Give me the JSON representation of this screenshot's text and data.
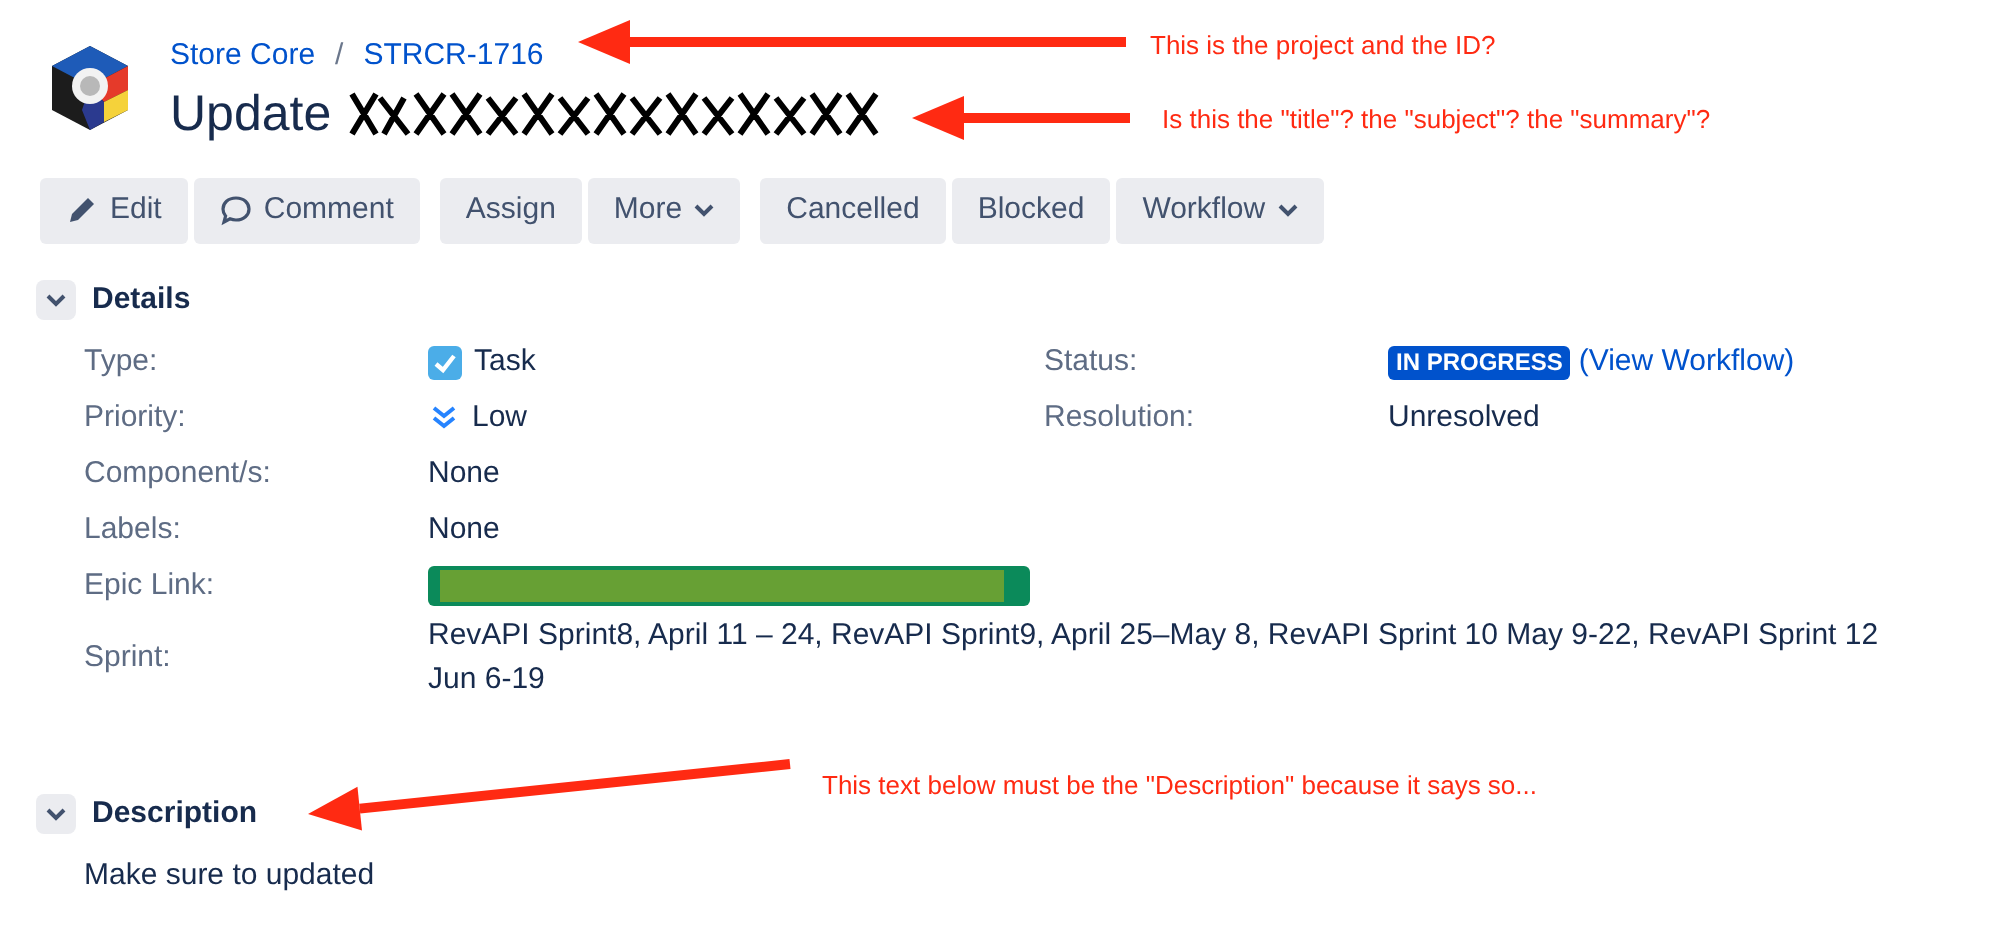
{
  "breadcrumb": {
    "project": "Store Core",
    "separator": "/",
    "issue_key": "STRCR-1716"
  },
  "title": "Update",
  "toolbar_groups": [
    [
      {
        "label": "Edit",
        "kind": "edit"
      },
      {
        "label": "Comment",
        "kind": "comment"
      }
    ],
    [
      {
        "label": "Assign",
        "kind": "plain"
      },
      {
        "label": "More",
        "kind": "menu"
      }
    ],
    [
      {
        "label": "Cancelled",
        "kind": "plain"
      },
      {
        "label": "Blocked",
        "kind": "plain"
      },
      {
        "label": "Workflow",
        "kind": "menu"
      }
    ]
  ],
  "details": {
    "heading": "Details",
    "expanded": true,
    "left": [
      {
        "label": "Type:",
        "value": "Task",
        "kind": "type"
      },
      {
        "label": "Priority:",
        "value": "Low",
        "kind": "priority"
      },
      {
        "label": "Component/s:",
        "value": "None",
        "kind": "text"
      },
      {
        "label": "Labels:",
        "value": "None",
        "kind": "text"
      },
      {
        "label": "Epic Link:",
        "kind": "redacted"
      },
      {
        "label": "Sprint:",
        "value": "RevAPI Sprint8, April 11 – 24, RevAPI Sprint9, April 25–May 8, RevAPI Sprint 10 May 9-22, RevAPI Sprint 12 Jun 6-19",
        "kind": "wide"
      }
    ],
    "right": [
      {
        "label": "Status:",
        "lozenge": "IN PROGRESS",
        "link": "(View Workflow)",
        "kind": "status"
      },
      {
        "label": "Resolution:",
        "value": "Unresolved",
        "kind": "text"
      }
    ]
  },
  "description": {
    "heading": "Description",
    "expanded": true,
    "text": "Make sure to updated"
  },
  "annotations": [
    {
      "text": "This is the project and the ID?"
    },
    {
      "text": "Is this the \"title\"? the \"subject\"? the \"summary\"?"
    },
    {
      "text": "This text below must be the \"Description\" because it says so..."
    }
  ]
}
